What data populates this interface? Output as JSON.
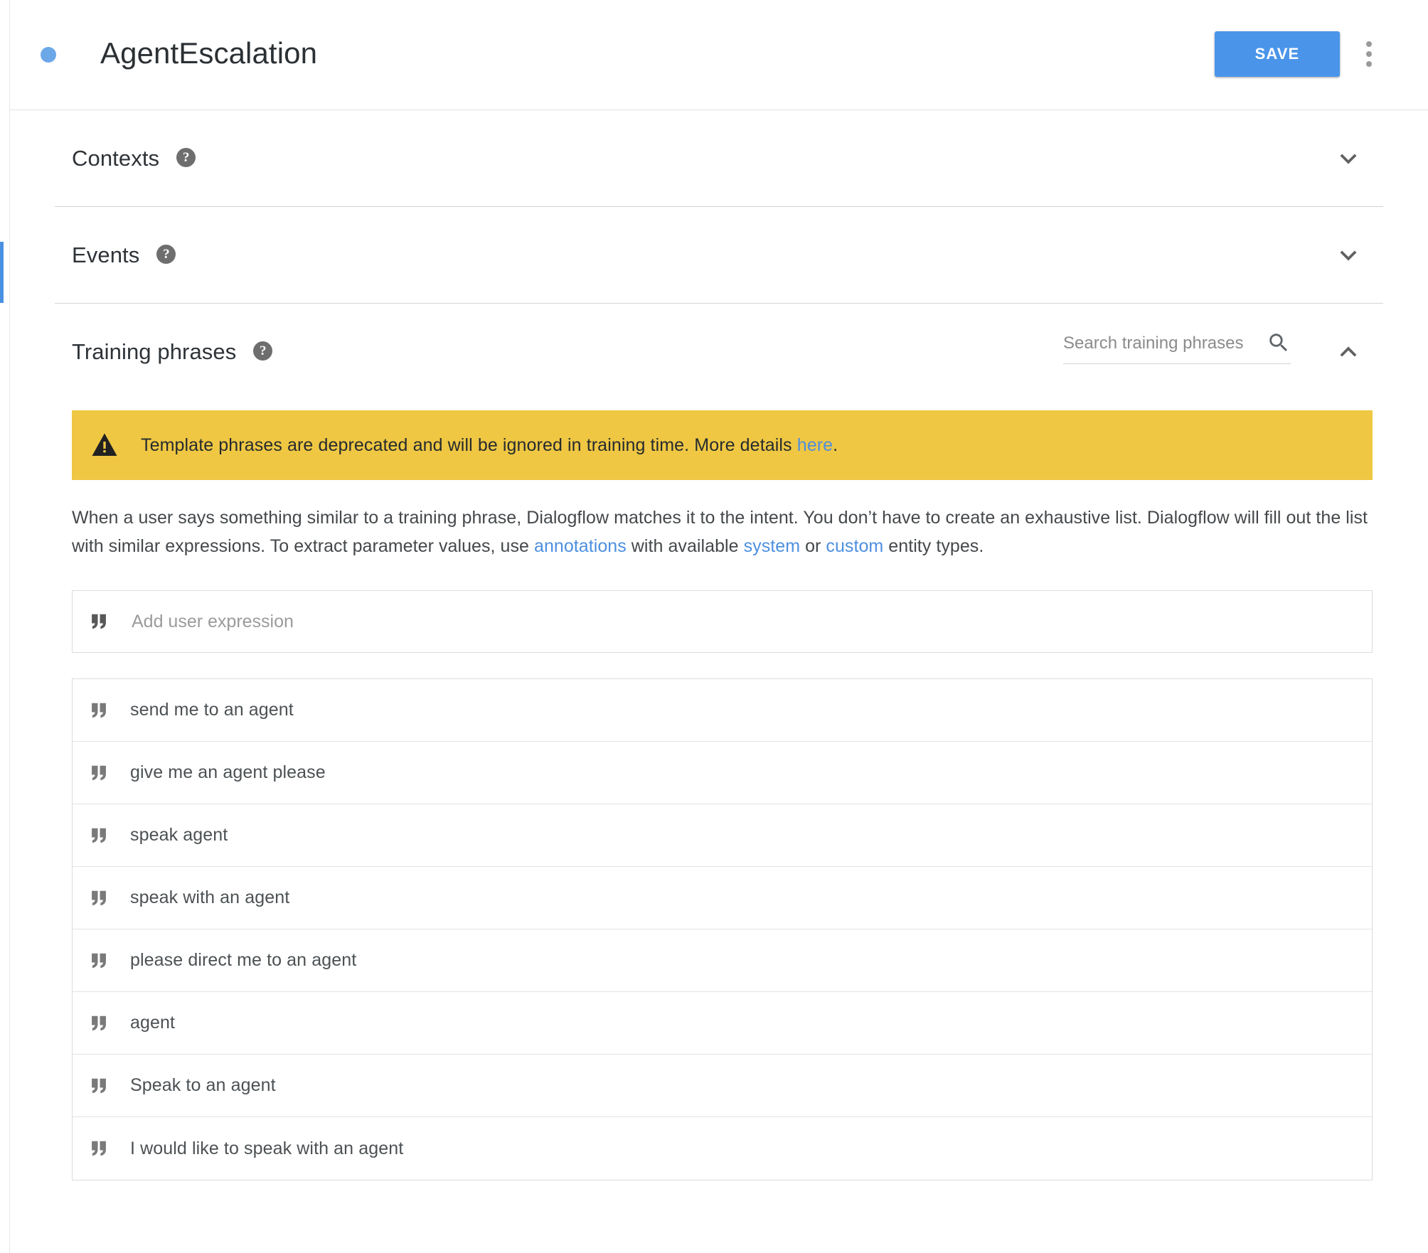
{
  "header": {
    "title": "AgentEscalation",
    "status_dot_color": "#6ca7e8",
    "save_label": "SAVE",
    "save_color": "#4a95ea",
    "overflow_icon": "more-vert-icon"
  },
  "sections": [
    {
      "title": "Contexts",
      "help_icon": "help-icon",
      "toggle_icon": "chevron-down-icon",
      "expanded": false
    },
    {
      "title": "Events",
      "help_icon": "help-icon",
      "toggle_icon": "chevron-down-icon",
      "expanded": false
    },
    {
      "title": "Training phrases",
      "help_icon": "help-icon",
      "toggle_icon": "chevron-up-icon",
      "expanded": true
    }
  ],
  "search": {
    "placeholder": "Search training phrases",
    "value": "",
    "icon": "search-icon"
  },
  "warning": {
    "icon": "warning-triangle-icon",
    "background": "#efc743",
    "text_before": "Template phrases are deprecated and will be ignored in training time. More details ",
    "link_label": "here",
    "text_after": "."
  },
  "description": {
    "part1": "When a user says something similar to a training phrase, Dialogflow matches it to the intent. You don’t have to create an exhaustive list. Dialogflow will fill out the list with similar expressions. To extract parameter values, use ",
    "link1": "annotations",
    "part2": " with available ",
    "link2": "system",
    "part3": " or ",
    "link3": "custom",
    "part4": " entity types.",
    "link_color": "#4d8fe0"
  },
  "add_expression": {
    "placeholder": "Add user expression",
    "value": "",
    "icon": "quote-icon"
  },
  "training_phrases": [
    {
      "text": "send me to an agent",
      "icon": "quote-icon"
    },
    {
      "text": "give me an agent please",
      "icon": "quote-icon"
    },
    {
      "text": "speak agent",
      "icon": "quote-icon"
    },
    {
      "text": "speak with an agent",
      "icon": "quote-icon"
    },
    {
      "text": "please direct me to an agent",
      "icon": "quote-icon"
    },
    {
      "text": "agent",
      "icon": "quote-icon"
    },
    {
      "text": "Speak to an agent",
      "icon": "quote-icon"
    },
    {
      "text": "I would like to speak with an agent",
      "icon": "quote-icon"
    }
  ],
  "scrollbar": {
    "thumb_color": "#4a90e2"
  }
}
